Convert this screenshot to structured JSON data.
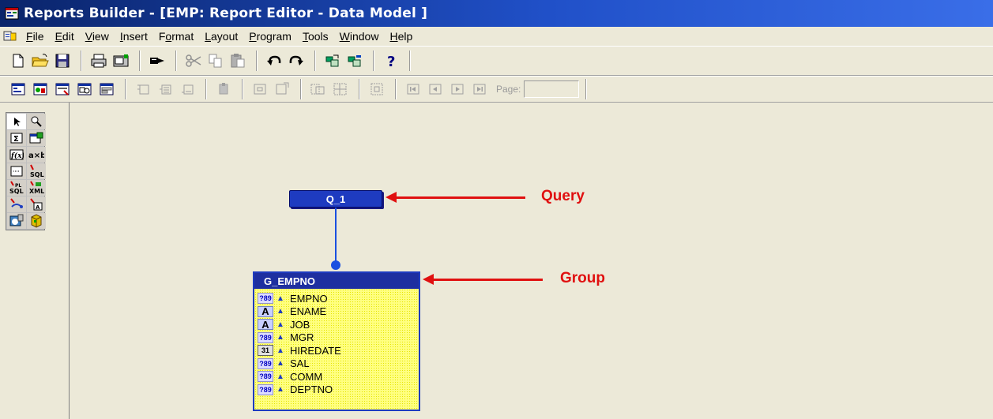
{
  "window": {
    "title": "Reports Builder - [EMP: Report Editor - Data Model ]"
  },
  "menu": {
    "items": [
      {
        "label": "File",
        "acc": "F",
        "rest": "ile"
      },
      {
        "label": "Edit",
        "acc": "E",
        "rest": "dit"
      },
      {
        "label": "View",
        "acc": "V",
        "rest": "iew"
      },
      {
        "label": "Insert",
        "acc": "I",
        "rest": "nsert"
      },
      {
        "label": "Format",
        "pre": "F",
        "acc": "o",
        "rest": "rmat"
      },
      {
        "label": "Layout",
        "acc": "L",
        "rest": "ayout"
      },
      {
        "label": "Program",
        "acc": "P",
        "rest": "rogram"
      },
      {
        "label": "Tools",
        "acc": "T",
        "rest": "ools"
      },
      {
        "label": "Window",
        "acc": "W",
        "rest": "indow"
      },
      {
        "label": "Help",
        "acc": "H",
        "rest": "elp"
      }
    ]
  },
  "toolbar2": {
    "page_label": "Page:",
    "page_value": ""
  },
  "palette": {
    "icons": [
      "select-arrow-icon",
      "magnify-icon",
      "summary-column-icon",
      "formula-column-icon",
      "function-icon",
      "placeholder-column-icon",
      "data-link-icon",
      "sql-query-icon",
      "plsql-query-icon",
      "xml-query-icon",
      "cross-product-icon",
      "ref-cursor-icon",
      "data-source-icon",
      "database-icon"
    ]
  },
  "data_model": {
    "query": {
      "name": "Q_1"
    },
    "group": {
      "name": "G_EMPNO",
      "columns": [
        {
          "type": "number",
          "type_label": "?89",
          "name": "EMPNO"
        },
        {
          "type": "char",
          "type_label": "A",
          "name": "ENAME"
        },
        {
          "type": "char",
          "type_label": "A",
          "name": "JOB"
        },
        {
          "type": "number",
          "type_label": "?89",
          "name": "MGR"
        },
        {
          "type": "date",
          "type_label": "31",
          "name": "HIREDATE"
        },
        {
          "type": "number",
          "type_label": "?89",
          "name": "SAL"
        },
        {
          "type": "number",
          "type_label": "?89",
          "name": "COMM"
        },
        {
          "type": "number",
          "type_label": "?89",
          "name": "DEPTNO"
        }
      ]
    }
  },
  "annotations": {
    "query_label": "Query",
    "group_label": "Group",
    "color": "#e01010"
  },
  "colors": {
    "title_bar": "#0a246a",
    "object_blue": "#1e3bc0",
    "group_fill": "#ffff80",
    "chrome": "#ece9d8"
  }
}
